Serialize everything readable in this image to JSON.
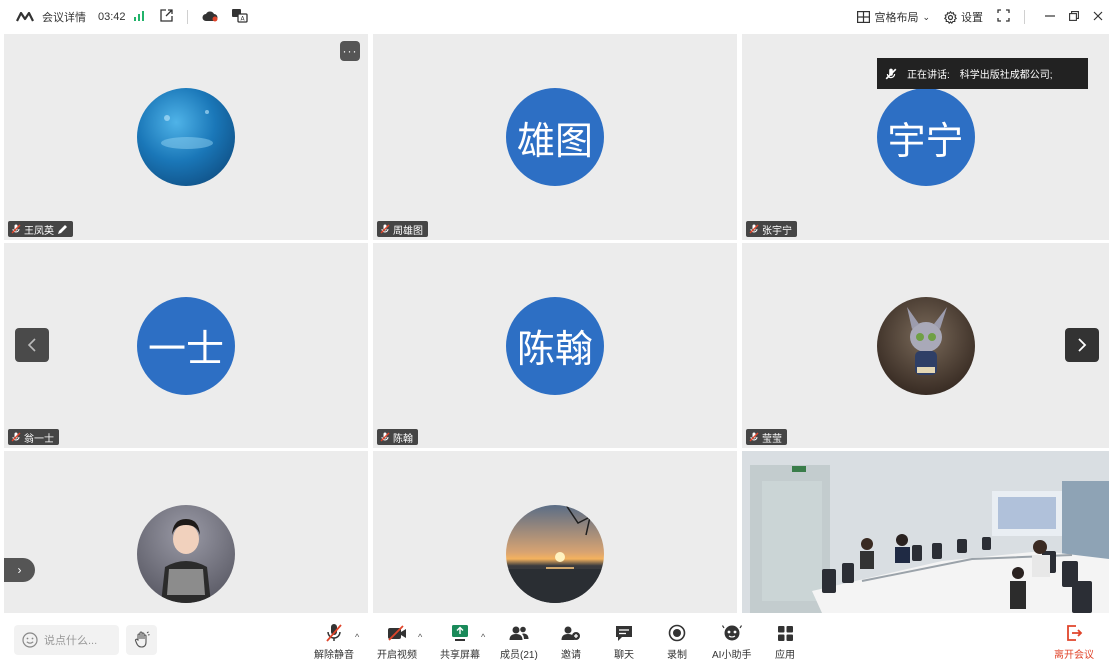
{
  "topbar": {
    "meeting_info": "会议详情",
    "timer": "03:42",
    "grid_layout": "宫格布局",
    "settings": "设置"
  },
  "speaking": {
    "label": "正在讲话:",
    "name": "科学出版社成都公司;"
  },
  "tiles": [
    {
      "name": "王凤英",
      "avatar_text": "",
      "avatar_kind": "photo-ocean"
    },
    {
      "name": "周雄图",
      "avatar_text": "雄图",
      "avatar_kind": "text"
    },
    {
      "name": "张宇宁",
      "avatar_text": "宇宁",
      "avatar_kind": "text"
    },
    {
      "name": "翁一士",
      "avatar_text": "一士",
      "avatar_kind": "text"
    },
    {
      "name": "陈翰",
      "avatar_text": "陈翰",
      "avatar_kind": "text"
    },
    {
      "name": "莹莹",
      "avatar_text": "",
      "avatar_kind": "photo-cartoon"
    },
    {
      "name": "",
      "avatar_text": "",
      "avatar_kind": "photo-person"
    },
    {
      "name": "",
      "avatar_text": "",
      "avatar_kind": "photo-sunset"
    },
    {
      "name": "",
      "avatar_text": "",
      "avatar_kind": "video-room"
    }
  ],
  "bottombar": {
    "chat_placeholder": "说点什么...",
    "tools": {
      "unmute": "解除静音",
      "start_video": "开启视频",
      "share_screen": "共享屏幕",
      "members": "成员(21)",
      "invite": "邀请",
      "chat": "聊天",
      "record": "录制",
      "ai_assistant": "AI小助手",
      "apps": "应用",
      "leave": "离开会议"
    }
  },
  "colors": {
    "avatar_blue": "#2d6fc4",
    "signal_green": "#21b36a",
    "active_border": "#3fbf8a",
    "leave_red": "#e0452b"
  }
}
